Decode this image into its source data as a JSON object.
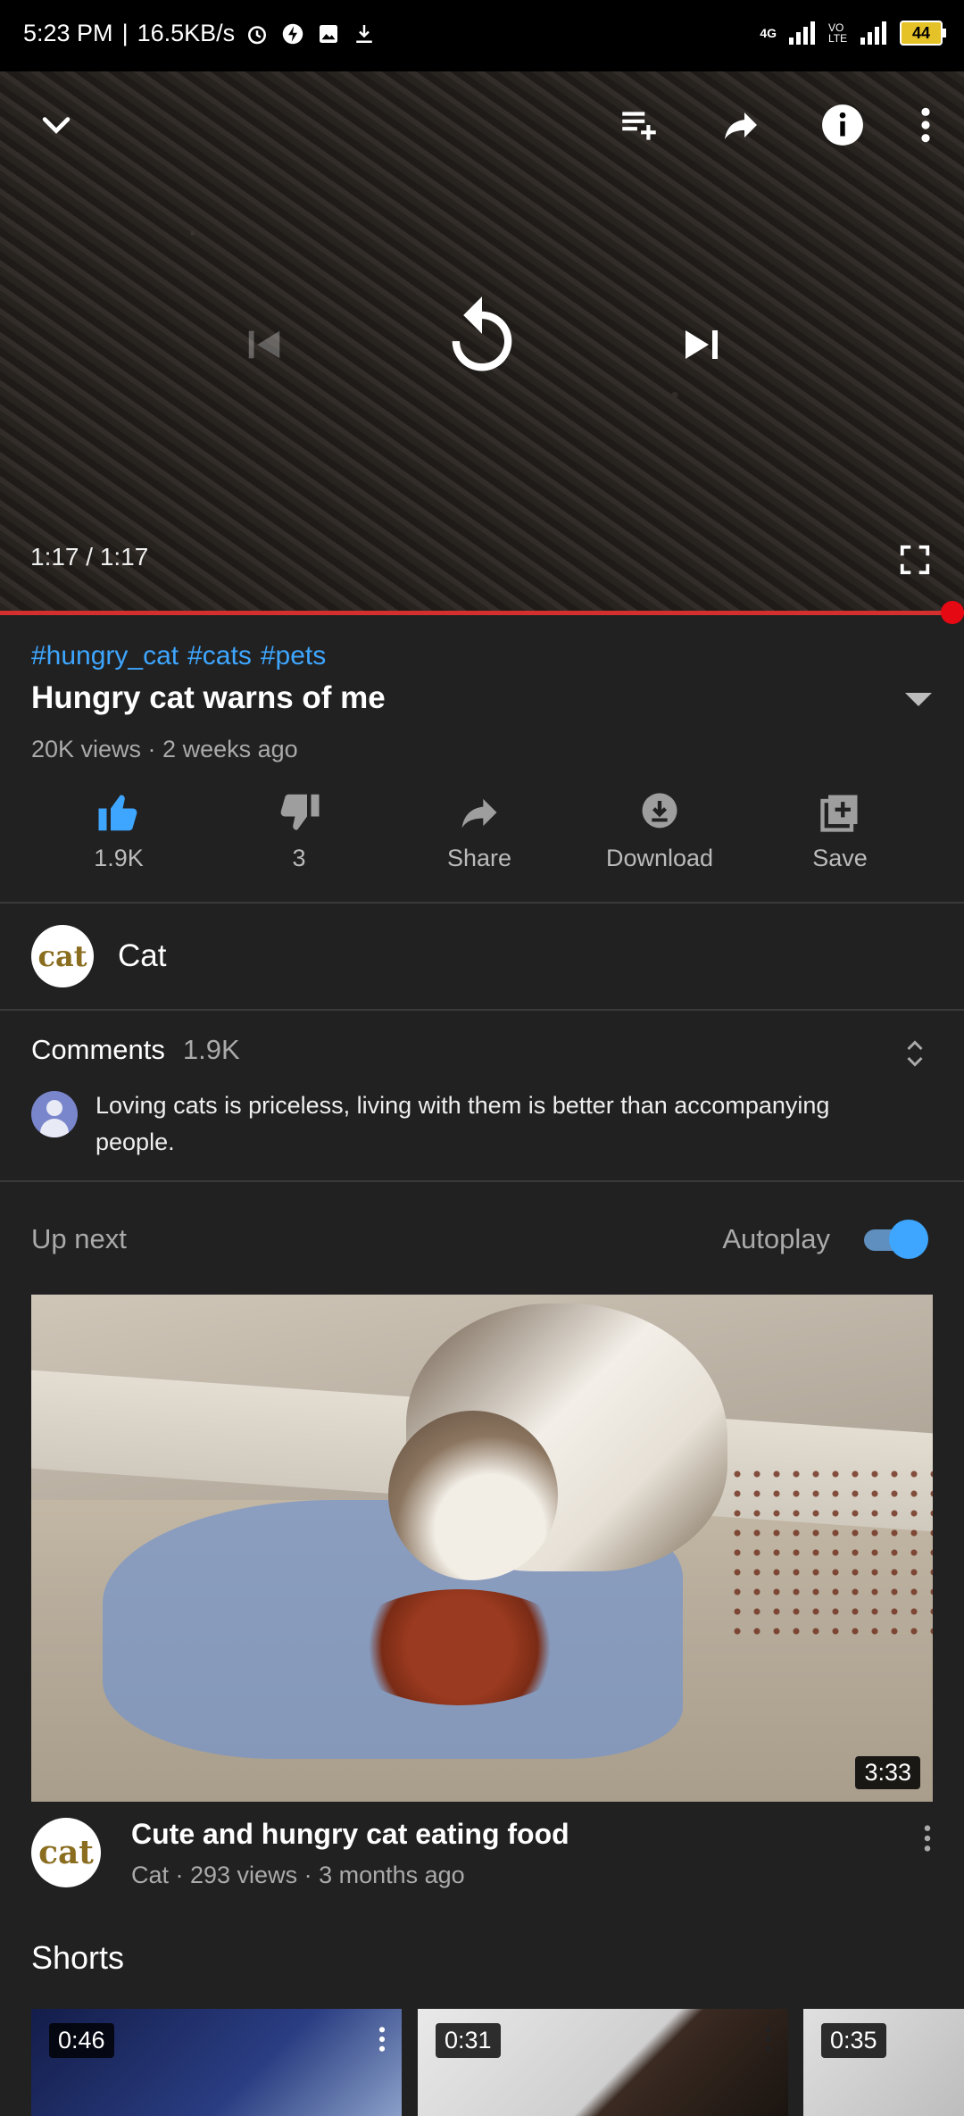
{
  "status_bar": {
    "time": "5:23 PM",
    "separator": "|",
    "speed": "16.5KB/s",
    "network": "4G",
    "volte": "VO LTE",
    "battery": "44"
  },
  "player": {
    "time": "1:17 / 1:17",
    "progress": 1.0,
    "icons": [
      "collapse-icon",
      "add-to-queue-icon",
      "share-icon",
      "info-icon",
      "more-icon",
      "previous-icon",
      "replay-icon",
      "next-icon",
      "fullscreen-icon"
    ]
  },
  "video": {
    "hashtags": [
      "#hungry_cat",
      "#cats",
      "#pets"
    ],
    "title": "Hungry cat warns of me",
    "meta": "20K views · 2 weeks ago"
  },
  "actions": [
    {
      "label": "1.9K",
      "icon": "like-icon"
    },
    {
      "label": "3",
      "icon": "dislike-icon"
    },
    {
      "label": "Share",
      "icon": "share-icon"
    },
    {
      "label": "Download",
      "icon": "download-icon"
    },
    {
      "label": "Save",
      "icon": "save-icon"
    }
  ],
  "channel": {
    "avatar_text": "cat",
    "name": "Cat"
  },
  "comments": {
    "label": "Comments",
    "count": "1.9K",
    "top_comment": "Loving cats is priceless, living with them is better than accompanying people."
  },
  "up_next": {
    "label": "Up next",
    "autoplay_label": "Autoplay",
    "autoplay_on": true
  },
  "recommended": {
    "duration": "3:33",
    "avatar_text": "cat",
    "title": "Cute and hungry cat eating food",
    "meta": "Cat · 293 views · 3 months ago"
  },
  "shorts": {
    "label": "Shorts",
    "items": [
      {
        "duration": "0:46"
      },
      {
        "duration": "0:31"
      },
      {
        "duration": "0:35"
      }
    ]
  },
  "colors": {
    "background": "#212121",
    "accent_blue": "#3ea6ff",
    "progress_red": "#e50914"
  }
}
